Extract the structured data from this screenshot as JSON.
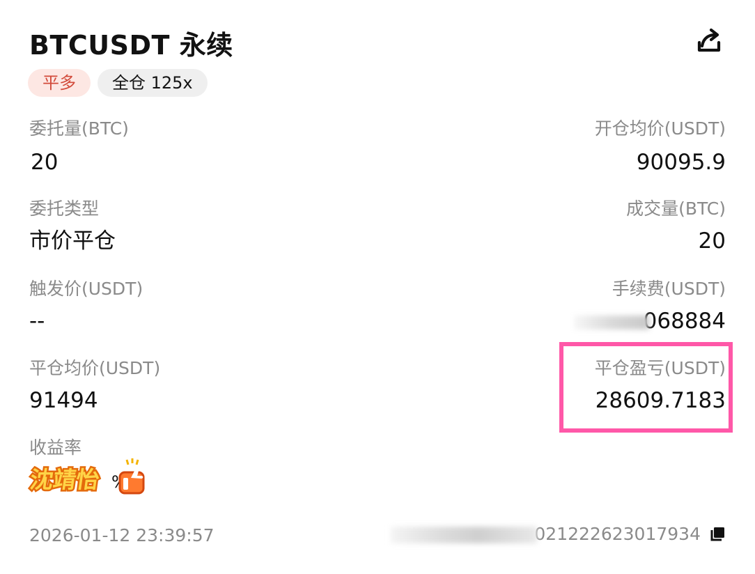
{
  "header": {
    "title": "BTCUSDT 永续",
    "share_icon": "share-icon"
  },
  "tags": {
    "side": "平多",
    "margin": "全仓 125x"
  },
  "fields": {
    "order_qty_label": "委托量(BTC)",
    "order_qty_value": "20",
    "avg_open_label": "开仓均价(USDT)",
    "avg_open_value": "90095.9",
    "order_type_label": "委托类型",
    "order_type_value": "市价平仓",
    "filled_qty_label": "成交量(BTC)",
    "filled_qty_value": "20",
    "trigger_price_label": "触发价(USDT)",
    "trigger_price_value": "--",
    "fee_label": "手续费(USDT)",
    "fee_value": "068884",
    "avg_close_label": "平仓均价(USDT)",
    "avg_close_value": "91494",
    "close_pnl_label": "平仓盈亏(USDT)",
    "close_pnl_value": "28609.7183",
    "yield_label": "收益率"
  },
  "sticker": {
    "text": "沈靖怡",
    "icon": "thumbs-up-icon"
  },
  "footer": {
    "timestamp": "2026-01-12 23:39:57",
    "order_id": "021222623017934",
    "copy_icon": "copy-icon"
  },
  "colors": {
    "accent_red": "#d24a3a",
    "tag_red_bg": "#fde7e3",
    "highlight_pink": "#ff58a8",
    "muted_gray": "#8a8a8a"
  }
}
